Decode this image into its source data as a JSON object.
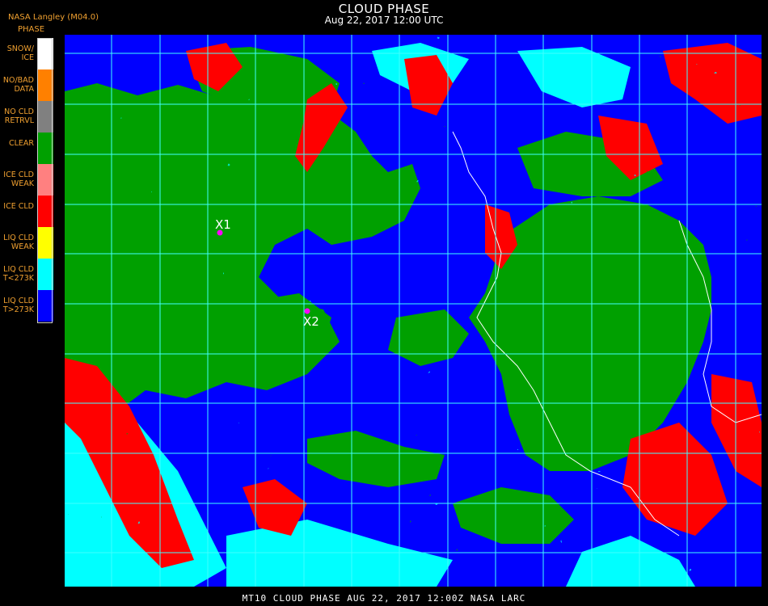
{
  "header": {
    "title": "CLOUD PHASE",
    "subtitle": "Aug 22, 2017 12:00 UTC",
    "provider": "NASA Langley (M04.0)",
    "legend_title": "PHASE"
  },
  "legend": [
    {
      "label": "SNOW/\nICE",
      "color": "#ffffff"
    },
    {
      "label": "NO/BAD\nDATA",
      "color": "#ff8000"
    },
    {
      "label": "NO CLD\nRETRVL",
      "color": "#808080"
    },
    {
      "label": "CLEAR",
      "color": "#00a000"
    },
    {
      "label": "ICE CLD\nWEAK",
      "color": "#ff8080"
    },
    {
      "label": "ICE CLD",
      "color": "#ff0000"
    },
    {
      "label": "LIQ CLD\nWEAK",
      "color": "#ffff00"
    },
    {
      "label": "LIQ CLD\nT<273K",
      "color": "#00ffff"
    },
    {
      "label": "LIQ CLD\nT>273K",
      "color": "#0000ff"
    }
  ],
  "markers": [
    {
      "label": "X1"
    },
    {
      "label": "X2"
    }
  ],
  "grid_color": "#40ffff",
  "marker_color": "#ff00ff",
  "footer": "MT10  CLOUD PHASE   AUG 22, 2017 12:00Z   NASA LARC"
}
